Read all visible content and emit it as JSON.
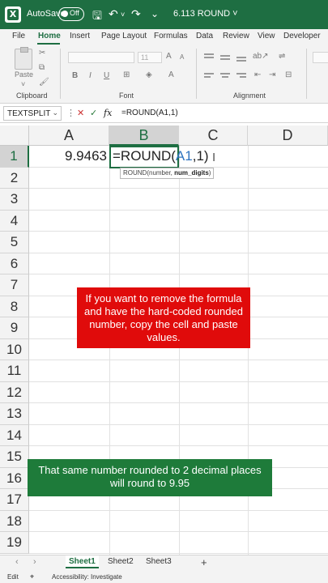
{
  "titlebar": {
    "autosave_label": "AutoSave",
    "autosave_state": "Off",
    "filename": "6.113 ROUND ˅"
  },
  "ribbon_tabs": [
    "File",
    "Home",
    "Insert",
    "Page Layout",
    "Formulas",
    "Data",
    "Review",
    "View",
    "Developer"
  ],
  "ribbon": {
    "paste_label": "Paste",
    "clipboard_label": "Clipboard",
    "font_label": "Font",
    "font_size": "11",
    "alignment_label": "Alignment",
    "bold": "B",
    "italic": "I",
    "underline": "U"
  },
  "formula_bar": {
    "name_box": "TEXTSPLIT",
    "fx": "fx",
    "content": "=ROUND(A1,1)"
  },
  "columns": [
    "A",
    "B",
    "C",
    "D"
  ],
  "rows": [
    "1",
    "2",
    "3",
    "4",
    "5",
    "6",
    "7",
    "8",
    "9",
    "10",
    "11",
    "12",
    "13",
    "14",
    "15",
    "16",
    "17",
    "18",
    "19"
  ],
  "cells": {
    "a1": "9.9463",
    "b1_prefix": "=ROUND(",
    "b1_ref": "A1",
    "b1_suffix": ",1)"
  },
  "tooltip": {
    "func": "ROUND(number, ",
    "arg": "num_digits",
    "end": ")"
  },
  "notes": {
    "red": "If you want to remove the formula and have the hard-coded rounded number, copy the cell and paste values.",
    "green": "That same number rounded to 2 decimal places will round to 9.95"
  },
  "sheets": [
    "Sheet1",
    "Sheet2",
    "Sheet3"
  ],
  "status": {
    "mode": "Edit",
    "accessibility": "Accessibility: Investigate"
  },
  "colors": {
    "brand": "#1e6e42",
    "red_note": "#e00b0b",
    "green_note": "#1e7b3a",
    "ref": "#2f74c0"
  }
}
